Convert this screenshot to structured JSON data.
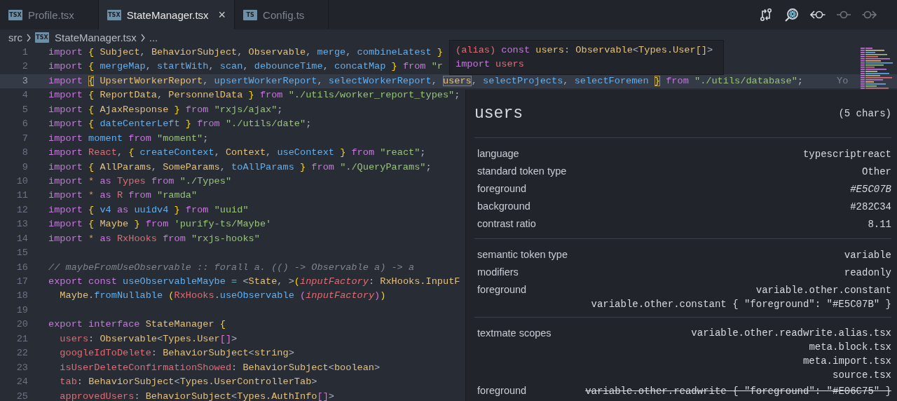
{
  "tabs": [
    {
      "label": "Profile.tsx",
      "icon_label": "TSX",
      "selected": false
    },
    {
      "label": "StateManager.tsx",
      "icon_label": "TSX",
      "selected": true,
      "close": "×"
    },
    {
      "label": "Config.ts",
      "icon_label": "TS",
      "selected": false
    }
  ],
  "toolbar": [
    {
      "kind": "compare",
      "disabled": false
    },
    {
      "kind": "search-atom",
      "disabled": false
    },
    {
      "kind": "back",
      "disabled": false
    },
    {
      "kind": "commit",
      "disabled": true
    },
    {
      "kind": "forward",
      "disabled": true
    }
  ],
  "breadcrumb": [
    {
      "label": "src"
    },
    {
      "label": "StateManager.tsx",
      "icon_label": "TSX"
    },
    {
      "label": "..."
    }
  ],
  "code": [
    {
      "number": "1",
      "current": false,
      "tokens": [
        {
          "text": "import ",
          "kind": "kw"
        },
        {
          "text": "{ ",
          "kind": "br"
        },
        {
          "text": "Subject",
          "kind": "ty"
        },
        {
          "text": ", ",
          "kind": "p"
        },
        {
          "text": "BehaviorSubject",
          "kind": "ty"
        },
        {
          "text": ", ",
          "kind": "p"
        },
        {
          "text": "Observable",
          "kind": "ty"
        },
        {
          "text": ", ",
          "kind": "p"
        },
        {
          "text": "merge",
          "kind": "fn"
        },
        {
          "text": ", ",
          "kind": "p"
        },
        {
          "text": "combineLatest ",
          "kind": "fn"
        },
        {
          "text": "}",
          "kind": "br"
        }
      ]
    },
    {
      "number": "2",
      "current": false,
      "tokens": [
        {
          "text": "import ",
          "kind": "kw"
        },
        {
          "text": "{ ",
          "kind": "br"
        },
        {
          "text": "mergeMap",
          "kind": "fn"
        },
        {
          "text": ", ",
          "kind": "p"
        },
        {
          "text": "startWith",
          "kind": "fn"
        },
        {
          "text": ", ",
          "kind": "p"
        },
        {
          "text": "scan",
          "kind": "fn"
        },
        {
          "text": ", ",
          "kind": "p"
        },
        {
          "text": "debounceTime",
          "kind": "fn"
        },
        {
          "text": ", ",
          "kind": "p"
        },
        {
          "text": "concatMap ",
          "kind": "fn"
        },
        {
          "text": "} ",
          "kind": "br"
        },
        {
          "text": "from ",
          "kind": "kw"
        },
        {
          "text": "\"r",
          "kind": "str"
        }
      ]
    },
    {
      "number": "3",
      "current": true,
      "blame": "Yo",
      "tokens": [
        {
          "text": "import ",
          "kind": "kw"
        },
        {
          "text": "{",
          "kind": "brm"
        },
        {
          "text": " UpsertWorkerReport",
          "kind": "ty"
        },
        {
          "text": ", ",
          "kind": "p"
        },
        {
          "text": "upsertWorkerReport",
          "kind": "fn"
        },
        {
          "text": ", ",
          "kind": "p"
        },
        {
          "text": "selectWorkerReport",
          "kind": "fn"
        },
        {
          "text": ", ",
          "kind": "p"
        },
        {
          "text": "users",
          "kind": "sel"
        },
        {
          "text": ", ",
          "kind": "p"
        },
        {
          "text": "selectProjects",
          "kind": "fn"
        },
        {
          "text": ", ",
          "kind": "p"
        },
        {
          "text": "selectForemen ",
          "kind": "fn"
        },
        {
          "text": "}",
          "kind": "brm"
        },
        {
          "text": " from ",
          "kind": "kw"
        },
        {
          "text": "\"./utils/database\"",
          "kind": "str"
        },
        {
          "text": ";",
          "kind": "p"
        }
      ]
    },
    {
      "number": "4",
      "current": false,
      "tokens": [
        {
          "text": "import ",
          "kind": "kw"
        },
        {
          "text": "{ ",
          "kind": "br"
        },
        {
          "text": "ReportData",
          "kind": "ty"
        },
        {
          "text": ", ",
          "kind": "p"
        },
        {
          "text": "PersonnelData ",
          "kind": "ty"
        },
        {
          "text": "} ",
          "kind": "br"
        },
        {
          "text": "from ",
          "kind": "kw"
        },
        {
          "text": "\"./utils/worker_report_types\"",
          "kind": "str"
        },
        {
          "text": ";",
          "kind": "p"
        }
      ]
    },
    {
      "number": "5",
      "current": false,
      "tokens": [
        {
          "text": "import ",
          "kind": "kw"
        },
        {
          "text": "{ ",
          "kind": "br"
        },
        {
          "text": "AjaxResponse ",
          "kind": "ty"
        },
        {
          "text": "} ",
          "kind": "br"
        },
        {
          "text": "from ",
          "kind": "kw"
        },
        {
          "text": "\"rxjs/ajax\"",
          "kind": "str"
        },
        {
          "text": ";",
          "kind": "p"
        }
      ]
    },
    {
      "number": "6",
      "current": false,
      "tokens": [
        {
          "text": "import ",
          "kind": "kw"
        },
        {
          "text": "{ ",
          "kind": "br"
        },
        {
          "text": "dateCenterLeft ",
          "kind": "fn"
        },
        {
          "text": "} ",
          "kind": "br"
        },
        {
          "text": "from ",
          "kind": "kw"
        },
        {
          "text": "\"./utils/date\"",
          "kind": "str"
        },
        {
          "text": ";",
          "kind": "p"
        }
      ]
    },
    {
      "number": "7",
      "current": false,
      "tokens": [
        {
          "text": "import ",
          "kind": "kw"
        },
        {
          "text": "moment ",
          "kind": "fn"
        },
        {
          "text": "from ",
          "kind": "kw"
        },
        {
          "text": "\"moment\"",
          "kind": "str"
        },
        {
          "text": ";",
          "kind": "p"
        }
      ]
    },
    {
      "number": "8",
      "current": false,
      "tokens": [
        {
          "text": "import ",
          "kind": "kw"
        },
        {
          "text": "React",
          "kind": "var"
        },
        {
          "text": ", ",
          "kind": "p"
        },
        {
          "text": "{ ",
          "kind": "br"
        },
        {
          "text": "createContext",
          "kind": "fn"
        },
        {
          "text": ", ",
          "kind": "p"
        },
        {
          "text": "Context",
          "kind": "ty"
        },
        {
          "text": ", ",
          "kind": "p"
        },
        {
          "text": "useContext ",
          "kind": "fn"
        },
        {
          "text": "} ",
          "kind": "br"
        },
        {
          "text": "from ",
          "kind": "kw"
        },
        {
          "text": "\"react\"",
          "kind": "str"
        },
        {
          "text": ";",
          "kind": "p"
        }
      ]
    },
    {
      "number": "9",
      "current": false,
      "tokens": [
        {
          "text": "import ",
          "kind": "kw"
        },
        {
          "text": "{ ",
          "kind": "br"
        },
        {
          "text": "AllParams",
          "kind": "ty"
        },
        {
          "text": ", ",
          "kind": "p"
        },
        {
          "text": "SomeParams",
          "kind": "ty"
        },
        {
          "text": ", ",
          "kind": "p"
        },
        {
          "text": "toAllParams ",
          "kind": "fn"
        },
        {
          "text": "} ",
          "kind": "br"
        },
        {
          "text": "from ",
          "kind": "kw"
        },
        {
          "text": "\"./QueryParams\"",
          "kind": "str"
        },
        {
          "text": ";",
          "kind": "p"
        }
      ]
    },
    {
      "number": "10",
      "current": false,
      "tokens": [
        {
          "text": "import ",
          "kind": "kw"
        },
        {
          "text": "* ",
          "kind": "op"
        },
        {
          "text": "as ",
          "kind": "kw"
        },
        {
          "text": "Types ",
          "kind": "var"
        },
        {
          "text": "from ",
          "kind": "kw"
        },
        {
          "text": "\"./Types\"",
          "kind": "str"
        }
      ]
    },
    {
      "number": "11",
      "current": false,
      "tokens": [
        {
          "text": "import ",
          "kind": "kw"
        },
        {
          "text": "* ",
          "kind": "op"
        },
        {
          "text": "as ",
          "kind": "kw"
        },
        {
          "text": "R ",
          "kind": "var"
        },
        {
          "text": "from ",
          "kind": "kw"
        },
        {
          "text": "\"ramda\"",
          "kind": "str"
        }
      ]
    },
    {
      "number": "12",
      "current": false,
      "tokens": [
        {
          "text": "import ",
          "kind": "kw"
        },
        {
          "text": "{ ",
          "kind": "br"
        },
        {
          "text": "v4 ",
          "kind": "fn"
        },
        {
          "text": "as ",
          "kind": "kw"
        },
        {
          "text": "uuidv4 ",
          "kind": "fn"
        },
        {
          "text": "} ",
          "kind": "br"
        },
        {
          "text": "from ",
          "kind": "kw"
        },
        {
          "text": "\"uuid\"",
          "kind": "str"
        }
      ]
    },
    {
      "number": "13",
      "current": false,
      "tokens": [
        {
          "text": "import ",
          "kind": "kw"
        },
        {
          "text": "{ ",
          "kind": "br"
        },
        {
          "text": "Maybe ",
          "kind": "ty"
        },
        {
          "text": "} ",
          "kind": "br"
        },
        {
          "text": "from ",
          "kind": "kw"
        },
        {
          "text": "'purify-ts/Maybe'",
          "kind": "str"
        }
      ]
    },
    {
      "number": "14",
      "current": false,
      "tokens": [
        {
          "text": "import ",
          "kind": "kw"
        },
        {
          "text": "* ",
          "kind": "op"
        },
        {
          "text": "as ",
          "kind": "kw"
        },
        {
          "text": "RxHooks ",
          "kind": "var"
        },
        {
          "text": "from ",
          "kind": "kw"
        },
        {
          "text": "\"rxjs-hooks\"",
          "kind": "str"
        }
      ]
    },
    {
      "number": "15",
      "current": false
    },
    {
      "number": "16",
      "current": false,
      "tokens": [
        {
          "text": "// maybeFromUseObservable :: forall a. (() -> Observable a) -> a",
          "kind": "cm"
        }
      ]
    },
    {
      "number": "17",
      "current": false,
      "tokens": [
        {
          "text": "export ",
          "kind": "kw"
        },
        {
          "text": "const ",
          "kind": "kw"
        },
        {
          "text": "useObservableMaybe ",
          "kind": "fn"
        },
        {
          "text": "= ",
          "kind": "cy"
        },
        {
          "text": "<",
          "kind": "p"
        },
        {
          "text": "State",
          "kind": "ty"
        },
        {
          "text": ", >",
          "kind": "p"
        },
        {
          "text": "(",
          "kind": "br"
        },
        {
          "text": "inputFactory",
          "kind": "prm"
        },
        {
          "text": ": ",
          "kind": "p"
        },
        {
          "text": "RxHooks.InputF",
          "kind": "ty"
        }
      ]
    },
    {
      "number": "18",
      "current": false,
      "tokens": [
        {
          "text": "  Maybe",
          "kind": "ty"
        },
        {
          "text": ".",
          "kind": "p"
        },
        {
          "text": "fromNullable ",
          "kind": "fn"
        },
        {
          "text": "(",
          "kind": "br"
        },
        {
          "text": "RxHooks",
          "kind": "var"
        },
        {
          "text": ".",
          "kind": "p"
        },
        {
          "text": "useObservable ",
          "kind": "fn"
        },
        {
          "text": "(",
          "kind": "pb"
        },
        {
          "text": "inputFactory",
          "kind": "prm"
        },
        {
          "text": ")",
          "kind": "pb"
        },
        {
          "text": ")",
          "kind": "br"
        }
      ]
    },
    {
      "number": "19",
      "current": false
    },
    {
      "number": "20",
      "current": false,
      "tokens": [
        {
          "text": "export ",
          "kind": "kw"
        },
        {
          "text": "interface ",
          "kind": "kw"
        },
        {
          "text": "StateManager ",
          "kind": "ty"
        },
        {
          "text": "{",
          "kind": "br"
        }
      ]
    },
    {
      "number": "21",
      "current": false,
      "tokens": [
        {
          "text": "  users",
          "kind": "var"
        },
        {
          "text": ": ",
          "kind": "p"
        },
        {
          "text": "Observable",
          "kind": "ty"
        },
        {
          "text": "<",
          "kind": "p"
        },
        {
          "text": "Types.User",
          "kind": "ty"
        },
        {
          "text": "[]",
          "kind": "pb"
        },
        {
          "text": ">",
          "kind": "p"
        }
      ]
    },
    {
      "number": "22",
      "current": false,
      "tokens": [
        {
          "text": "  googleIdToDelete",
          "kind": "var"
        },
        {
          "text": ": ",
          "kind": "p"
        },
        {
          "text": "BehaviorSubject",
          "kind": "ty"
        },
        {
          "text": "<",
          "kind": "p"
        },
        {
          "text": "string",
          "kind": "ty"
        },
        {
          "text": ">",
          "kind": "p"
        }
      ]
    },
    {
      "number": "23",
      "current": false,
      "tokens": [
        {
          "text": "  isUserDeleteConfirmationShowed",
          "kind": "var"
        },
        {
          "text": ": ",
          "kind": "p"
        },
        {
          "text": "BehaviorSubject",
          "kind": "ty"
        },
        {
          "text": "<",
          "kind": "p"
        },
        {
          "text": "boolean",
          "kind": "ty"
        },
        {
          "text": ">",
          "kind": "p"
        }
      ]
    },
    {
      "number": "24",
      "current": false,
      "tokens": [
        {
          "text": "  tab",
          "kind": "var"
        },
        {
          "text": ": ",
          "kind": "p"
        },
        {
          "text": "BehaviorSubject",
          "kind": "ty"
        },
        {
          "text": "<",
          "kind": "p"
        },
        {
          "text": "Types.UserControllerTab",
          "kind": "ty"
        },
        {
          "text": ">",
          "kind": "p"
        }
      ]
    },
    {
      "number": "25",
      "current": false,
      "tokens": [
        {
          "text": "  approvedUsers",
          "kind": "var"
        },
        {
          "text": ": ",
          "kind": "p"
        },
        {
          "text": "BehaviorSubject",
          "kind": "ty"
        },
        {
          "text": "<",
          "kind": "p"
        },
        {
          "text": "Types.AuthInfo",
          "kind": "ty"
        },
        {
          "text": "[]",
          "kind": "pb"
        },
        {
          "text": ">",
          "kind": "p"
        }
      ]
    }
  ],
  "hover": {
    "lines": [
      [
        {
          "text": "(alias) ",
          "kind": "var"
        },
        {
          "text": "const ",
          "kind": "kw"
        },
        {
          "text": "users",
          "kind": "ty"
        },
        {
          "text": ": ",
          "kind": "p"
        },
        {
          "text": "Observable",
          "kind": "ty"
        },
        {
          "text": "<",
          "kind": "p"
        },
        {
          "text": "Types.User[]",
          "kind": "ty"
        },
        {
          "text": ">",
          "kind": "p"
        }
      ],
      [
        {
          "text": "import ",
          "kind": "kw"
        },
        {
          "text": "users",
          "kind": "var"
        }
      ]
    ]
  },
  "inspector": {
    "title": "users",
    "length": "(5 chars)",
    "sections": [
      {
        "rows": [
          {
            "label": "language",
            "values": [
              "typescriptreact"
            ],
            "kind": "plain"
          },
          {
            "label": "standard token type",
            "values": [
              "Other"
            ],
            "kind": "plain"
          },
          {
            "label": "foreground",
            "values": [
              "#E5C07B"
            ],
            "kind": "italic"
          },
          {
            "label": "background",
            "values": [
              "#282C34"
            ],
            "kind": "plain"
          },
          {
            "label": "contrast ratio",
            "values": [
              "8.11"
            ],
            "kind": "plain"
          }
        ]
      },
      {
        "rows": [
          {
            "label": "semantic token type",
            "values": [
              "variable"
            ],
            "kind": "plain"
          },
          {
            "label": "modifiers",
            "values": [
              "readonly"
            ],
            "kind": "plain"
          },
          {
            "label": "foreground",
            "values": [
              "variable.other.constant",
              "variable.other.constant { \"foreground\": \"#E5C07B\" }"
            ],
            "kind": "plain"
          }
        ]
      },
      {
        "rows": [
          {
            "label": "textmate scopes",
            "values": [
              "variable.other.readwrite.alias.tsx",
              "meta.block.tsx",
              "meta.import.tsx",
              "source.tsx"
            ],
            "kind": "plain"
          },
          {
            "label": "foreground",
            "values": [
              "variable.other.readwrite { \"foreground\": \"#E06C75\" }"
            ],
            "kind": "struck"
          }
        ]
      }
    ]
  }
}
